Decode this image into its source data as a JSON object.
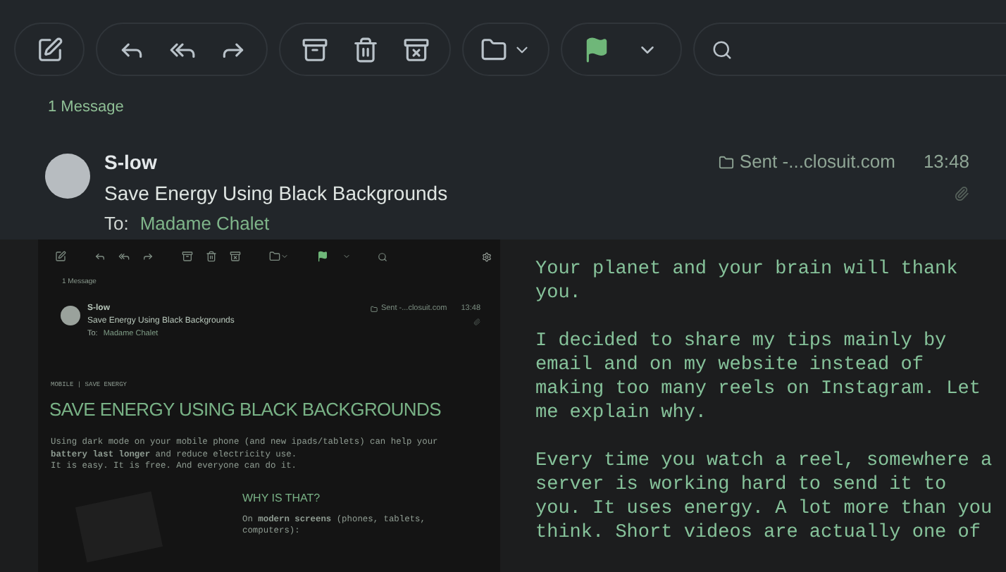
{
  "thread": {
    "message_count": "1 Message",
    "sender": "S-low",
    "subject": "Save Energy Using Black Backgrounds",
    "to_label": "To:",
    "recipient": "Madame Chalet",
    "mailbox": "Sent -...closuit.com",
    "time": "13:48"
  },
  "embedded_screenshot": {
    "message_count": "1 Message",
    "sender": "S-low",
    "subject": "Save Energy Using Black Backgrounds",
    "to_label": "To:",
    "recipient": "Madame Chalet",
    "mailbox": "Sent -...closuit.com",
    "time": "13:48",
    "breadcrumb": "MOBILE | SAVE ENERGY",
    "title": "SAVE ENERGY USING BLACK BACKGROUNDS",
    "intro": [
      "Using dark mode on your mobile phone (and new ipads/tablets) can help your **battery last longer** and reduce electricity use.",
      "It is easy. It is free. And everyone can do it."
    ],
    "section_heading": "WHY IS THAT?",
    "section_text": "On **modern screens** (phones, tablets, computers):"
  },
  "text_paragraphs": [
    "Your planet and your brain will thank you.",
    "I decided to share my tips mainly by email and on my website instead of making too many reels on Instagram. Let me explain why.",
    "Every time you watch a reel, somewhere a server is working hard to send it to you. It uses energy. A lot more than you think. Short videos are actually one of"
  ]
}
